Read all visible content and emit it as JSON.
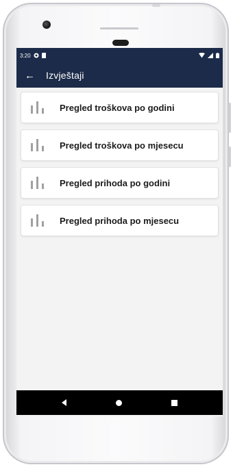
{
  "status_bar": {
    "time": "3:20"
  },
  "app_bar": {
    "back_icon": "←",
    "title": "Izvještaji"
  },
  "menu": {
    "items": [
      {
        "label": "Pregled troškova po godini",
        "icon": "bar-chart-icon"
      },
      {
        "label": "Pregled troškova po mjesecu",
        "icon": "bar-chart-icon"
      },
      {
        "label": "Pregled prihoda po godini",
        "icon": "bar-chart-icon"
      },
      {
        "label": "Pregled prihoda po mjesecu",
        "icon": "bar-chart-icon"
      }
    ]
  },
  "colors": {
    "app_bar": "#1c2b49",
    "background": "#f3f3f3",
    "icon_gray": "#a0a0a0",
    "nav_bar": "#000000"
  }
}
